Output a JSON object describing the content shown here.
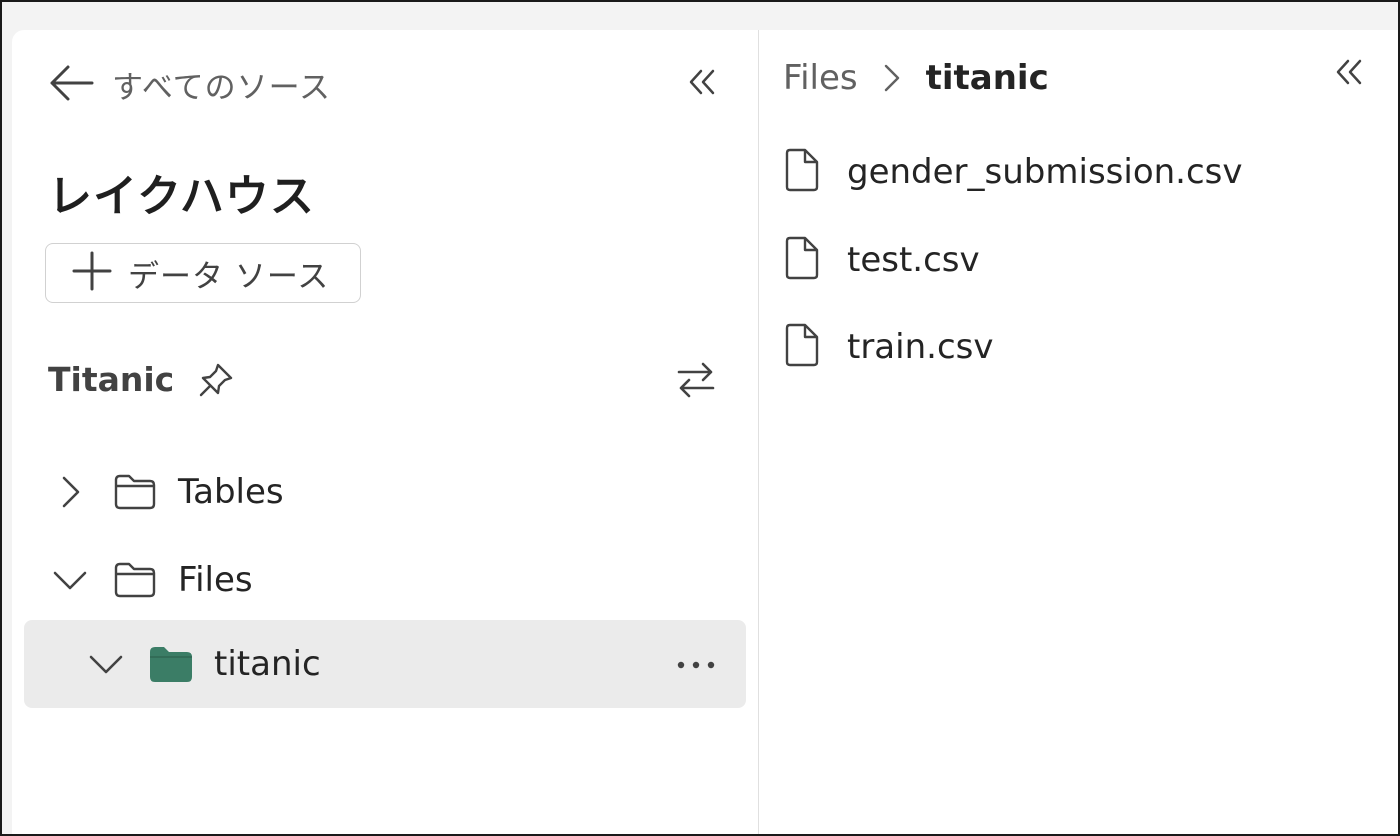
{
  "nav": {
    "back_label": "すべてのソース"
  },
  "explorer": {
    "title": "レイクハウス",
    "add_source_label": "データ ソース",
    "workspace_name": "Titanic",
    "tree": [
      {
        "label": "Tables",
        "expanded": false,
        "icon": "folder-outline-icon"
      },
      {
        "label": "Files",
        "expanded": true,
        "icon": "folder-outline-icon"
      },
      {
        "label": "titanic",
        "expanded": true,
        "selected": true,
        "icon": "folder-filled-icon"
      }
    ]
  },
  "content": {
    "breadcrumb": [
      "Files",
      "titanic"
    ],
    "files": [
      "gender_submission.csv",
      "test.csv",
      "train.csv"
    ]
  },
  "colors": {
    "accent_folder": "#3b7d66",
    "selected_row_bg": "#ebebeb",
    "border": "#1a1a1a"
  }
}
